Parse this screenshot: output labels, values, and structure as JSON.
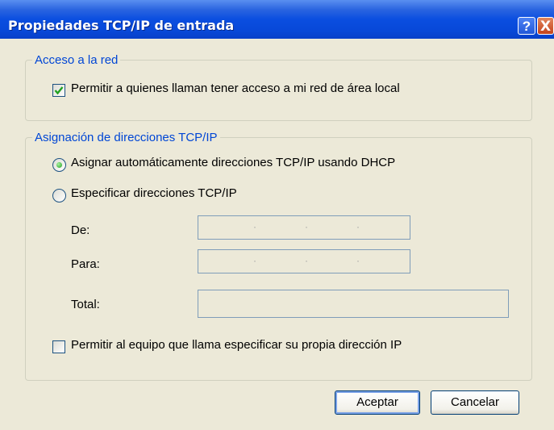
{
  "window": {
    "title": "Propiedades TCP/IP de entrada",
    "help_label": "?",
    "close_label": "X"
  },
  "network_access": {
    "legend": "Acceso a la red",
    "allow_lan_label": "Permitir a quienes llaman tener acceso a mi red de área local",
    "allow_lan_checked": true
  },
  "tcpip_assignment": {
    "legend": "Asignación de direcciones TCP/IP",
    "dhcp_label": "Asignar automáticamente direcciones TCP/IP usando DHCP",
    "dhcp_selected": true,
    "specify_label": "Especificar direcciones TCP/IP",
    "specify_selected": false,
    "from_label": "De:",
    "from_value": "",
    "to_label": "Para:",
    "to_value": "",
    "total_label": "Total:",
    "total_value": "",
    "allow_own_ip_label": "Permitir al equipo que llama especificar su propia dirección IP",
    "allow_own_ip_checked": false
  },
  "buttons": {
    "ok_label": "Aceptar",
    "cancel_label": "Cancelar"
  },
  "colors": {
    "title_bar": "#0848d8",
    "group_legend": "#0046d5",
    "dialog_background": "#ece9d8",
    "radio_selected": "#21a121",
    "check_mark": "#21a121"
  }
}
